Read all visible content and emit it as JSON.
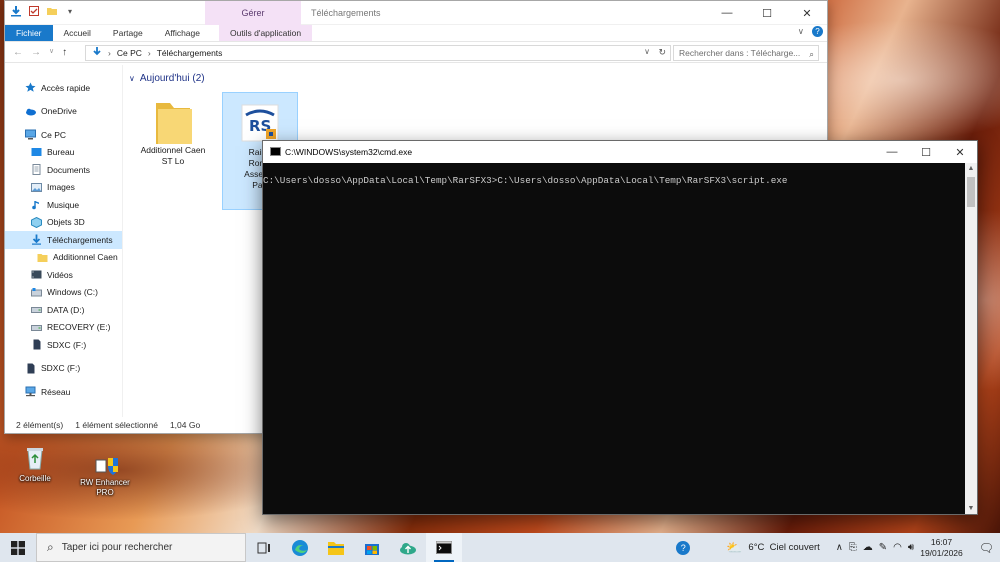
{
  "explorer": {
    "title": "Téléchargements",
    "contextual_tab_group": "Gérer",
    "ribbon_tabs": [
      "Fichier",
      "Accueil",
      "Partage",
      "Affichage",
      "Outils d'application"
    ],
    "breadcrumb": [
      "Ce PC",
      "Téléchargements"
    ],
    "search_placeholder": "Rechercher dans : Télécharge...",
    "nav": [
      {
        "label": "Accès rapide",
        "icon": "star-icon"
      },
      {
        "label": "OneDrive",
        "icon": "cloud-icon"
      },
      {
        "label": "Ce PC",
        "icon": "pc-icon"
      },
      {
        "label": "Bureau",
        "icon": "desktop-folder-icon"
      },
      {
        "label": "Documents",
        "icon": "documents-icon"
      },
      {
        "label": "Images",
        "icon": "images-icon"
      },
      {
        "label": "Musique",
        "icon": "music-icon"
      },
      {
        "label": "Objets 3D",
        "icon": "cube-icon"
      },
      {
        "label": "Téléchargements",
        "icon": "download-icon"
      },
      {
        "label": "Additionnel Caen",
        "icon": "folder-icon"
      },
      {
        "label": "Vidéos",
        "icon": "video-icon"
      },
      {
        "label": "Windows (C:)",
        "icon": "windows-drive-icon"
      },
      {
        "label": "DATA (D:)",
        "icon": "drive-icon"
      },
      {
        "label": "RECOVERY (E:)",
        "icon": "drive-icon"
      },
      {
        "label": "SDXC (F:)",
        "icon": "sd-card-icon"
      },
      {
        "label": "SDXC (F:)",
        "icon": "sd-card-icon"
      },
      {
        "label": "Réseau",
        "icon": "network-icon"
      }
    ],
    "group_header": "Aujourd'hui (2)",
    "files": [
      {
        "name_l1": "Additionnel Caen",
        "name_l2": "ST Lo",
        "icon": "folder-icon"
      },
      {
        "name_l1": "RailSt",
        "name_l2": "Roma",
        "name_l3": "AssetPa",
        "name_l4": "Part",
        "icon": "rs-installer-icon"
      }
    ],
    "status": {
      "count": "2 élément(s)",
      "selection": "1 élément sélectionné",
      "size": "1,04 Go"
    }
  },
  "cmd": {
    "title": "C:\\WINDOWS\\system32\\cmd.exe",
    "line": "C:\\Users\\dosso\\AppData\\Local\\Temp\\RarSFX3>C:\\Users\\dosso\\AppData\\Local\\Temp\\RarSFX3\\script.exe"
  },
  "desktop": {
    "icons": [
      {
        "label": "Corbeille"
      },
      {
        "label_l1": "RW Enhancer",
        "label_l2": "PRO"
      }
    ]
  },
  "taskbar": {
    "search_placeholder": "Taper ici pour rechercher",
    "weather": "6°C  Ciel couvert",
    "time": "16:07",
    "date": "19/01/2026"
  }
}
